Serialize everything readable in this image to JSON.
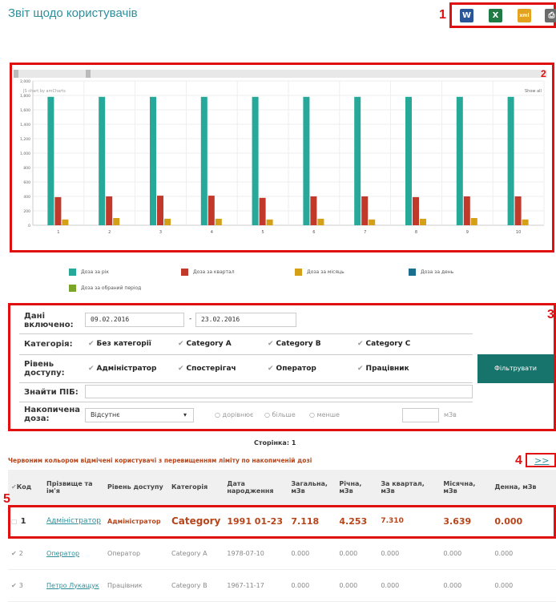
{
  "header": {
    "title": "Звіт щодо користувачів"
  },
  "markers": {
    "m1": "1",
    "m2": "2",
    "m3": "3",
    "m4": "4",
    "m5": "5"
  },
  "export": {
    "icons": [
      {
        "name": "word-export-icon",
        "glyph": "W",
        "color": "#2a5699"
      },
      {
        "name": "excel-export-icon",
        "glyph": "X",
        "color": "#1f7a45"
      },
      {
        "name": "xml-export-icon",
        "glyph": "xml",
        "color": "#e3a321"
      },
      {
        "name": "print-icon",
        "glyph": "⎙",
        "color": "#6b6b6b"
      }
    ]
  },
  "chart": {
    "credit": "JS chart by amCharts",
    "show_all": "Show all",
    "legend": [
      {
        "label": "Доза за рік",
        "color": "#26a99a"
      },
      {
        "label": "Доза за квартал",
        "color": "#c0392b"
      },
      {
        "label": "Доза за місяць",
        "color": "#d4a017"
      },
      {
        "label": "Доза за день",
        "color": "#1a6f8f"
      },
      {
        "label": "Доза за обраний період",
        "color": "#7aa52a"
      }
    ]
  },
  "chart_data": {
    "type": "bar",
    "categories": [
      "1",
      "2",
      "3",
      "4",
      "5",
      "6",
      "7",
      "8",
      "9",
      "10"
    ],
    "ylim": [
      0,
      2000
    ],
    "yticks": [
      "2,000",
      "1,800",
      "1,600",
      "1,400",
      "1,200",
      "1,000",
      "800",
      "600",
      "400",
      "200",
      "0"
    ],
    "series": [
      {
        "name": "Доза за рік",
        "color": "#26a99a",
        "values": [
          1780,
          1780,
          1780,
          1780,
          1780,
          1780,
          1780,
          1780,
          1780,
          1780
        ]
      },
      {
        "name": "Доза за квартал",
        "color": "#c0392b",
        "values": [
          390,
          400,
          410,
          410,
          380,
          400,
          400,
          390,
          400,
          400
        ]
      },
      {
        "name": "Доза за місяць",
        "color": "#d4a017",
        "values": [
          80,
          100,
          90,
          90,
          80,
          90,
          80,
          90,
          100,
          80
        ]
      }
    ]
  },
  "filter": {
    "date_label": "Дані включено:",
    "date_from": "09.02.2016",
    "date_to": "23.02.2016",
    "date_dash": "-",
    "category_label": "Категорія:",
    "categories": [
      "Без категорії",
      "Category A",
      "Category B",
      "Category C"
    ],
    "access_label": "Рівень доступу:",
    "access_levels": [
      "Адміністратор",
      "Спостерігач",
      "Оператор",
      "Працівник"
    ],
    "search_label": "Знайти ПІБ:",
    "search_value": "",
    "dose_label": "Накопичена доза:",
    "dose_select": "Відсутнє",
    "radios": [
      "дорівнює",
      "більше",
      "менше"
    ],
    "dose_unit": "мЗв",
    "button": "Фільтрувати"
  },
  "pager": {
    "label": "Сторінка: 1",
    "next": ">>"
  },
  "notice": "Червоним кольором відмічені користувачі з перевищенням ліміту по накопиченій дозі",
  "table": {
    "headers": [
      "Код",
      "Прізвище та ім'я",
      "Рівень доступу",
      "Категорія",
      "Дата народження",
      "Загальна, мЗв",
      "Річна, мЗв",
      "За квартал, мЗв",
      "Місячна, мЗв",
      "Денна, мЗв"
    ],
    "rows": [
      {
        "code": "1",
        "name": "Адміністратор",
        "access": "Адміністратор",
        "category": "Category",
        "birth": "1991 01-23",
        "total": "7.118",
        "year": "4.253",
        "quarter": "7.310",
        "month": "3.639",
        "day": "0.000"
      },
      {
        "code": "2",
        "name": "Оператор",
        "access": "Оператор",
        "category": "Category A",
        "birth": "1978-07-10",
        "total": "0.000",
        "year": "0.000",
        "quarter": "0.000",
        "month": "0.000",
        "day": "0.000"
      },
      {
        "code": "3",
        "name": "Петро Лукащук",
        "access": "Працівник",
        "category": "Category B",
        "birth": "1967-11-17",
        "total": "0.000",
        "year": "0.000",
        "quarter": "0.000",
        "month": "0.000",
        "day": "0.000"
      }
    ]
  }
}
